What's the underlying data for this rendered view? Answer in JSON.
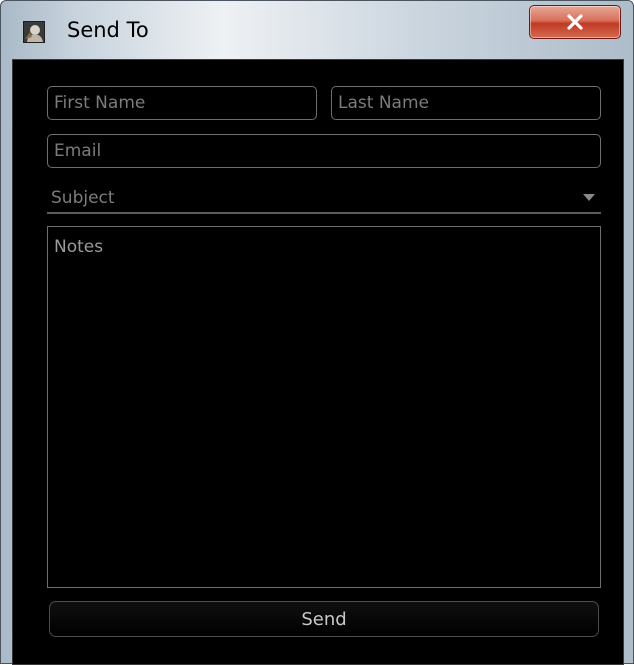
{
  "window": {
    "title": "Send To",
    "icon": "app-photo-icon",
    "close_icon": "close-x-icon",
    "close_label": "X"
  },
  "form": {
    "first_name_placeholder": "First Name",
    "last_name_placeholder": "Last Name",
    "email_placeholder": "Email",
    "subject_label": "Subject",
    "subject_icon": "dropdown-arrow-icon",
    "notes_placeholder": "Notes",
    "send_label": "Send"
  },
  "colors": {
    "client_background": "#000000",
    "field_border": "#6e6e6e",
    "placeholder_text": "#7c7c7c",
    "close_button": "#c8432c"
  }
}
